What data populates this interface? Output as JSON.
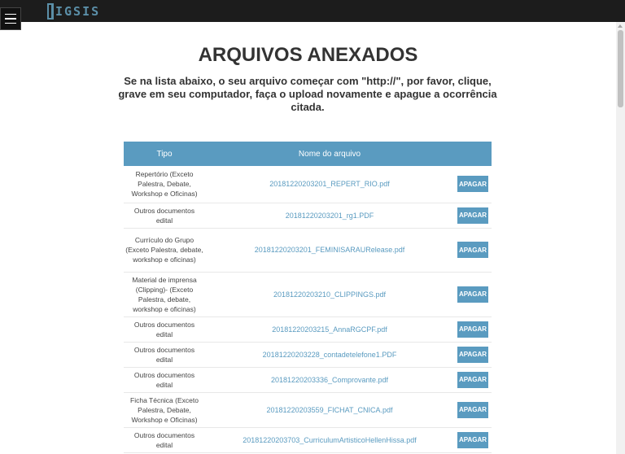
{
  "header": {
    "logo_text": "IGSIS"
  },
  "main": {
    "title": "ARQUIVOS ANEXADOS",
    "subtitle": "Se na lista abaixo, o seu arquivo começar com \"http://\", por favor, clique, grave em seu computador, faça o upload novamente e apague a ocorrência citada."
  },
  "table": {
    "headers": [
      "Tipo",
      "Nome do arquivo",
      ""
    ],
    "action_label": "APAGAR",
    "rows": [
      {
        "tipo": "Repertório (Exceto Palestra, Debate, Workshop e Oficinas)",
        "file": "20181220203201_REPERT_RIO.pdf"
      },
      {
        "tipo": "Outros documentos edital",
        "file": "20181220203201_rg1.PDF"
      },
      {
        "tipo": "Currículo do Grupo (Exceto Palestra, debate, workshop e oficinas)",
        "file": "20181220203201_FEMINISARAURelease.pdf"
      },
      {
        "tipo": "Material de imprensa (Clipping)- (Exceto Palestra, debate, workshop e oficinas)",
        "file": "20181220203210_CLIPPINGS.pdf"
      },
      {
        "tipo": "Outros documentos edital",
        "file": "20181220203215_AnnaRGCPF.pdf"
      },
      {
        "tipo": "Outros documentos edital",
        "file": "20181220203228_contadetelefone1.PDF"
      },
      {
        "tipo": "Outros documentos edital",
        "file": "20181220203336_Comprovante.pdf"
      },
      {
        "tipo": "Ficha Técnica (Exceto Palestra, Debate, Workshop e Oficinas)",
        "file": "20181220203559_FICHAT_CNICA.pdf"
      },
      {
        "tipo": "Outros documentos edital",
        "file": "20181220203703_CurriculumArtisticoHellenHissa.pdf"
      }
    ]
  },
  "colors": {
    "accent": "#5a9bc0",
    "topbar": "#1c1c1c",
    "title_text": "#333333"
  },
  "icons": {
    "menu": "hamburger-icon",
    "scroll_up": "scroll-up-arrow-icon"
  }
}
